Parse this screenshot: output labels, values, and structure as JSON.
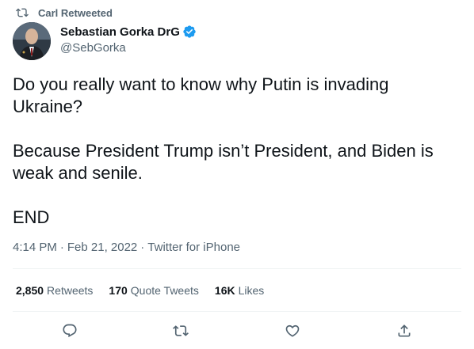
{
  "social_context": {
    "text": "Carl Retweeted",
    "icon": "retweet-icon"
  },
  "author": {
    "display_name": "Sebastian Gorka DrG",
    "handle": "@SebGorka",
    "verified": true,
    "verified_color": "#1d9bf0"
  },
  "tweet": {
    "paragraphs": [
      "Do you really want to know why Putin is invading Ukraine?",
      "Because President Trump isn’t President, and Biden is weak and senile.",
      "END"
    ],
    "time": "4:14 PM",
    "separator": "·",
    "date": "Feb 21, 2022",
    "source": "Twitter for iPhone"
  },
  "stats": {
    "retweets": {
      "count": "2,850",
      "label": "Retweets"
    },
    "quote_tweets": {
      "count": "170",
      "label": "Quote Tweets"
    },
    "likes": {
      "count": "16K",
      "label": "Likes"
    }
  },
  "actions": [
    "reply-icon",
    "retweet-icon",
    "like-icon",
    "share-icon"
  ],
  "colors": {
    "text": "#0f1419",
    "secondary": "#536471",
    "divider": "#eff3f4",
    "accent": "#1d9bf0"
  }
}
